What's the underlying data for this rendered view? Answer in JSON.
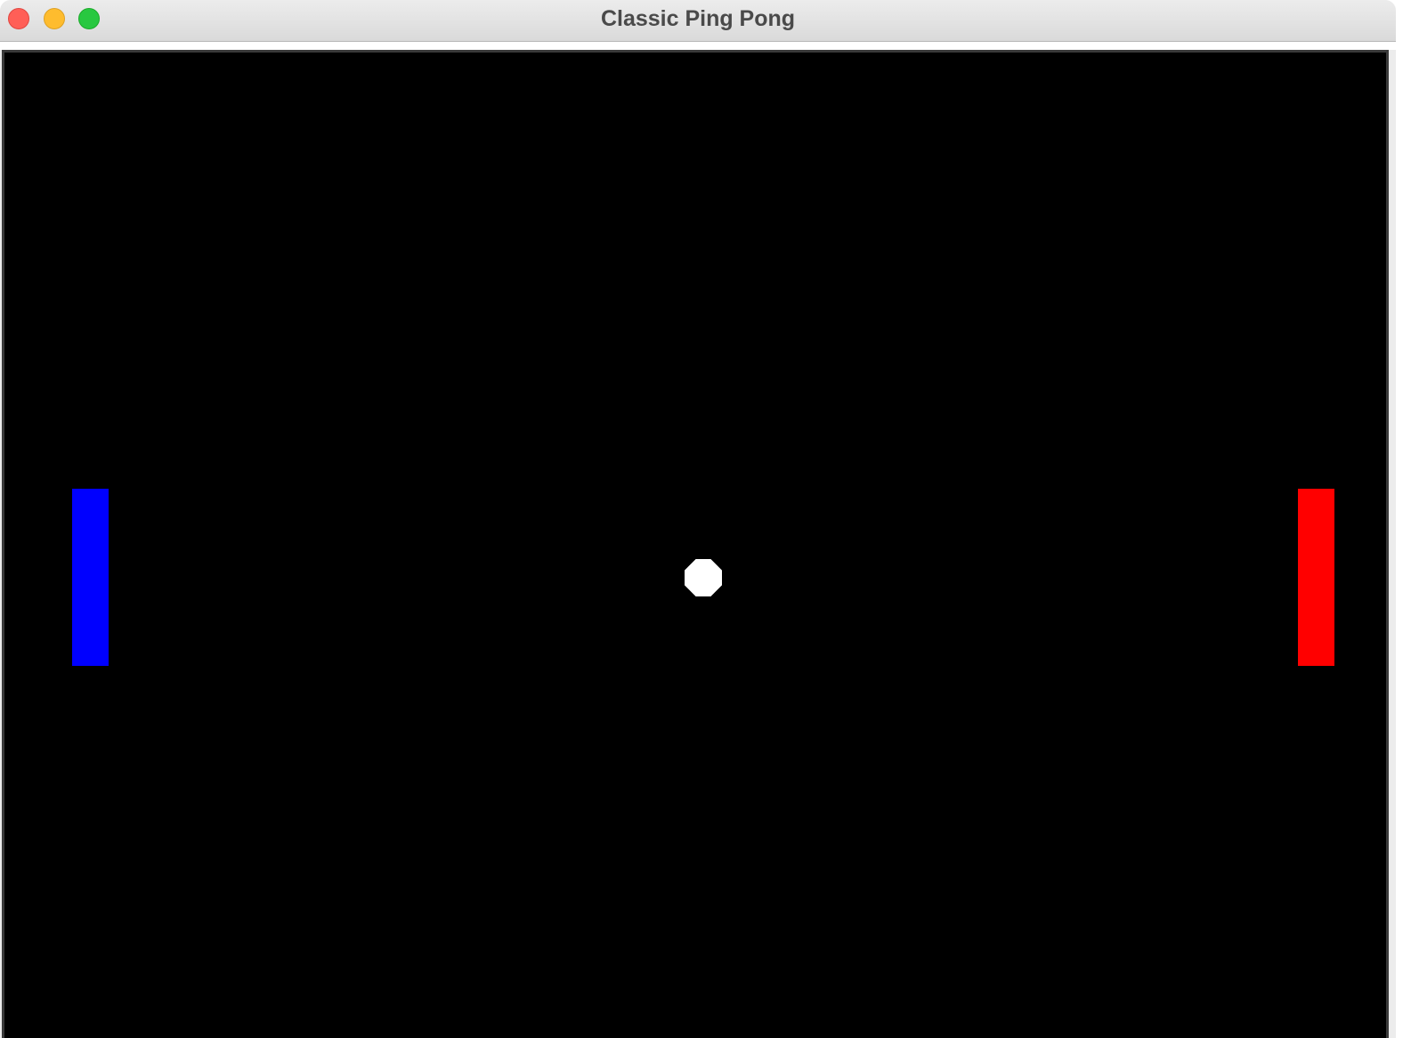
{
  "window": {
    "title": "Classic Ping Pong"
  },
  "window_controls": {
    "close_icon": "close-icon",
    "minimize_icon": "minimize-icon",
    "maximize_icon": "maximize-icon"
  },
  "game": {
    "court_color": "#000000",
    "left_paddle_color": "#0000ff",
    "right_paddle_color": "#ff0000",
    "ball_color": "#ffffff"
  }
}
